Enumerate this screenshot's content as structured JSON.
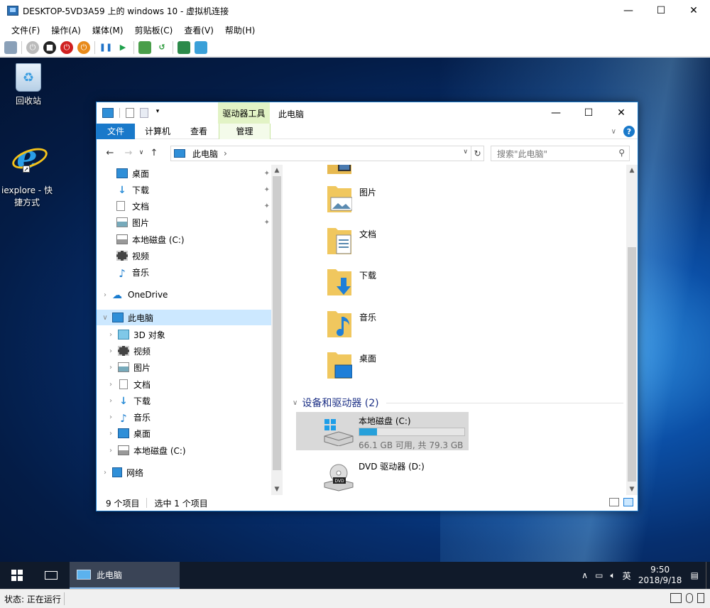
{
  "vm": {
    "title": "DESKTOP-5VD3A59 上的 windows 10 - 虚拟机连接",
    "menu": [
      "文件(F)",
      "操作(A)",
      "媒体(M)",
      "剪贴板(C)",
      "查看(V)",
      "帮助(H)"
    ],
    "status": "状态: 正在运行"
  },
  "desktop": {
    "icons": [
      {
        "label": "回收站"
      },
      {
        "label": "iexplore - 快\n捷方式"
      }
    ]
  },
  "explorer": {
    "context_tab": "驱动器工具",
    "title": "此电脑",
    "ribbon_tabs": [
      "文件",
      "计算机",
      "查看",
      "管理"
    ],
    "address_crumb": "此电脑",
    "search_placeholder": "搜索\"此电脑\"",
    "quick_access": [
      {
        "label": "桌面",
        "icon": "desktop-icon",
        "pinned": true
      },
      {
        "label": "下载",
        "icon": "download-icon",
        "pinned": true
      },
      {
        "label": "文档",
        "icon": "documents-icon",
        "pinned": true
      },
      {
        "label": "图片",
        "icon": "pictures-icon",
        "pinned": true
      },
      {
        "label": "本地磁盘 (C:)",
        "icon": "drive-icon",
        "pinned": false
      },
      {
        "label": "视频",
        "icon": "video-icon",
        "pinned": false
      },
      {
        "label": "音乐",
        "icon": "music-icon",
        "pinned": false
      }
    ],
    "onedrive_label": "OneDrive",
    "this_pc_label": "此电脑",
    "this_pc_children": [
      {
        "label": "3D 对象",
        "icon": "cube-3d-icon"
      },
      {
        "label": "视频",
        "icon": "video-icon"
      },
      {
        "label": "图片",
        "icon": "pictures-icon"
      },
      {
        "label": "文档",
        "icon": "documents-icon"
      },
      {
        "label": "下载",
        "icon": "download-icon"
      },
      {
        "label": "音乐",
        "icon": "music-icon"
      },
      {
        "label": "桌面",
        "icon": "desktop-icon"
      },
      {
        "label": "本地磁盘 (C:)",
        "icon": "drive-icon"
      }
    ],
    "network_label": "网络",
    "folders": [
      {
        "name": "",
        "icon": "video-folder-icon"
      },
      {
        "name": "图片",
        "icon": "pictures-folder-icon"
      },
      {
        "name": "文档",
        "icon": "documents-folder-icon"
      },
      {
        "name": "下载",
        "icon": "download-folder-icon"
      },
      {
        "name": "音乐",
        "icon": "music-folder-icon"
      },
      {
        "name": "桌面",
        "icon": "desktop-folder-icon"
      }
    ],
    "devices_header": "设备和驱动器 (2)",
    "drives": [
      {
        "name": "本地磁盘 (C:)",
        "size": "66.1 GB 可用, 共 79.3 GB",
        "used_fraction": 0.17,
        "selected": true
      },
      {
        "name": "DVD 驱动器 (D:)",
        "size": "",
        "selected": false
      }
    ],
    "status_items": "9 个项目",
    "status_selected": "选中 1 个项目"
  },
  "taskbar": {
    "app_label": "此电脑",
    "ime": "英",
    "time": "9:50",
    "date": "2018/9/18"
  }
}
